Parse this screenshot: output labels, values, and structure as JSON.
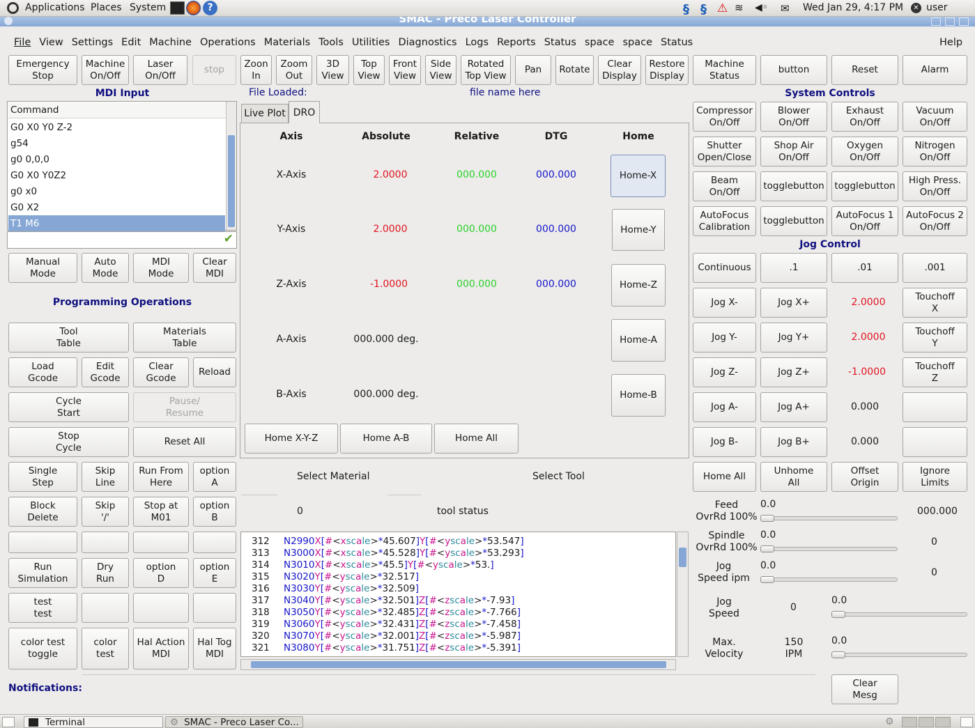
{
  "panel": {
    "apps": "Applications",
    "places": "Places",
    "system": "System",
    "datetime": "Wed Jan 29,  4:17 PM",
    "user": "user"
  },
  "window": {
    "title": "SMAC - Preco Laser Controller"
  },
  "menu": [
    "File",
    "View",
    "Settings",
    "Edit",
    "Machine",
    "Operations",
    "Materials",
    "Tools",
    "Utilities",
    "Diagnostics",
    "Logs",
    "Reports",
    "Status",
    "space",
    "space",
    "Status"
  ],
  "menu_help": "Help",
  "toolbar": {
    "emergency": "Emergency\nStop",
    "machine": "Machine\nOn/Off",
    "laser": "Laser\nOn/Off",
    "stop": "stop",
    "zoom_in": "Zoon\nIn",
    "zoom_out": "Zoom\nOut",
    "view3d": "3D\nView",
    "top": "Top\nView",
    "front": "Front\nView",
    "side": "Side\nView",
    "rotated": "Rotated\nTop View",
    "pan": "Pan",
    "rotate": "Rotate",
    "clear": "Clear\nDisplay",
    "restore": "Restore\nDisplay",
    "mstatus": "Machine\nStatus",
    "button": "button",
    "reset": "Reset",
    "alarm": "Alarm"
  },
  "mdi": {
    "title": "MDI Input",
    "column": "Command",
    "commands": [
      "G0 X0 Y0 Z-2",
      "g54",
      "g0 0,0,0",
      "G0 X0 Y0Z2",
      "g0 x0",
      "G0 X2",
      "T1 M6"
    ],
    "selected": 6
  },
  "modes": {
    "manual": "Manual\nMode",
    "auto": "Auto\nMode",
    "mdi": "MDI\nMode",
    "clear": "Clear\nMDI"
  },
  "prog": {
    "title": "Programming Operations",
    "tool_table": "Tool\nTable",
    "materials_table": "Materials\nTable",
    "load": "Load\nGcode",
    "edit": "Edit\nGcode",
    "clear": "Clear\nGcode",
    "reload": "Reload",
    "cycle_start": "Cycle\nStart",
    "pause": "Pause/\nResume",
    "stop_cycle": "Stop\nCycle",
    "reset_all": "Reset All",
    "single_step": "Single\nStep",
    "skip_line": "Skip\nLine",
    "run_from": "Run From\nHere",
    "option_a": "option\nA",
    "block_delete": "Block\nDelete",
    "skip_slash": "Skip\n'/'",
    "stop_m01": "Stop at\nM01",
    "option_b": "option\nB",
    "run_sim": "Run\nSimulation",
    "dry_run": "Dry\nRun",
    "option_d": "option\nD",
    "option_e": "option\nE",
    "test": "test\ntest",
    "color_toggle": "color test\ntoggle",
    "color_test": "color\ntest",
    "hal_action": "Hal Action\nMDI",
    "hal_tog": "Hal Tog\nMDI"
  },
  "notifications": "Notifications:",
  "file": {
    "label": "File Loaded:",
    "name": "file name here"
  },
  "tabs": [
    "Live Plot",
    "DRO"
  ],
  "dro": {
    "headers": [
      "Axis",
      "Absolute",
      "Relative",
      "DTG",
      "Home"
    ],
    "rows": [
      {
        "axis": "X-Axis",
        "abs": "2.0000",
        "rel": "000.000",
        "dtg": "000.000",
        "home": "Home-X"
      },
      {
        "axis": "Y-Axis",
        "abs": "2.0000",
        "rel": "000.000",
        "dtg": "000.000",
        "home": "Home-Y"
      },
      {
        "axis": "Z-Axis",
        "abs": "-1.0000",
        "rel": "000.000",
        "dtg": "000.000",
        "home": "Home-Z"
      },
      {
        "axis": "A-Axis",
        "abs": "000.000 deg.",
        "rel": "",
        "dtg": "",
        "home": "Home-A"
      },
      {
        "axis": "B-Axis",
        "abs": "000.000 deg.",
        "rel": "",
        "dtg": "",
        "home": "Home-B"
      }
    ],
    "home_xyz": "Home X-Y-Z",
    "home_ab": "Home A-B",
    "home_all": "Home All"
  },
  "select_material": "Select Material",
  "select_tool": "Select Tool",
  "material_value": "0",
  "tool_status": "tool status",
  "gcode": [
    {
      "n": "312",
      "t": "N2990X[#<xscale>*45.607]Y[#<yscale>*53.547]"
    },
    {
      "n": "313",
      "t": "N3000X[#<xscale>*45.528]Y[#<yscale>*53.293]"
    },
    {
      "n": "314",
      "t": "N3010X[#<xscale>*45.5]Y[#<yscale>*53.]"
    },
    {
      "n": "315",
      "t": "N3020Y[#<yscale>*32.517]"
    },
    {
      "n": "316",
      "t": "N3030Y[#<yscale>*32.509]"
    },
    {
      "n": "317",
      "t": "N3040Y[#<yscale>*32.501]Z[#<zscale>*-7.93]"
    },
    {
      "n": "318",
      "t": "N3050Y[#<yscale>*32.485]Z[#<zscale>*-7.766]"
    },
    {
      "n": "319",
      "t": "N3060Y[#<yscale>*32.431]Z[#<zscale>*-7.458]"
    },
    {
      "n": "320",
      "t": "N3070Y[#<yscale>*32.001]Z[#<zscale>*-5.987]"
    },
    {
      "n": "321",
      "t": "N3080Y[#<yscale>*31.751]Z[#<zscale>*-5.391]"
    }
  ],
  "sys": {
    "title": "System Controls",
    "compressor": "Compressor\nOn/Off",
    "blower": "Blower\nOn/Off",
    "exhaust": "Exhaust\nOn/Off",
    "vacuum": "Vacuum\nOn/Off",
    "shutter": "Shutter\nOpen/Close",
    "shop_air": "Shop Air\nOn/Off",
    "oxygen": "Oxygen\nOn/Off",
    "nitrogen": "Nitrogen\nOn/Off",
    "beam": "Beam\nOn/Off",
    "toggle1": "togglebutton",
    "toggle2": "togglebutton",
    "high_press": "High Press.\nOn/Off",
    "af_cal": "AutoFocus\nCalibration",
    "toggle3": "togglebutton",
    "af1": "AutoFocus 1\nOn/Off",
    "af2": "AutoFocus 2\nOn/Off"
  },
  "jog": {
    "title": "Jog Control",
    "continuous": "Continuous",
    "inc1": ".1",
    "inc2": ".01",
    "inc3": ".001",
    "rows": [
      {
        "minus": "Jog X-",
        "plus": "Jog X+",
        "val": "2.0000",
        "touch": "Touchoff\nX"
      },
      {
        "minus": "Jog Y-",
        "plus": "Jog Y+",
        "val": "2.0000",
        "touch": "Touchoff\nY"
      },
      {
        "minus": "Jog Z-",
        "plus": "Jog Z+",
        "val": "-1.0000",
        "touch": "Touchoff\nZ"
      },
      {
        "minus": "Jog A-",
        "plus": "Jog A+",
        "val": "0.000",
        "touch": ""
      },
      {
        "minus": "Jog B-",
        "plus": "Jog B+",
        "val": "0.000",
        "touch": ""
      }
    ],
    "home_all": "Home All",
    "unhome_all": "Unhome\nAll",
    "offset_origin": "Offset\nOrigin",
    "ignore_limits": "Ignore\nLimits"
  },
  "overrides": {
    "feed_label": "Feed\nOvrRd 100%",
    "feed_val": "0.0",
    "feed_out": "000.000",
    "spindle_label": "Spindle\nOvrRd 100%",
    "spindle_val": "0.0",
    "spindle_out": "0",
    "jogspeed_label": "Jog\nSpeed ipm",
    "jogspeed_val": "0.0",
    "jogspeed_out": "0",
    "jog_speed_label": "Jog\nSpeed",
    "jog_speed_mid": "0",
    "jog_speed_val": "0.0",
    "maxvel_label": "Max.\nVelocity",
    "maxvel_mid": "150\nIPM",
    "maxvel_val": "0.0",
    "clear_mesg": "Clear\nMesg"
  },
  "taskbar": {
    "terminal": "Terminal",
    "smac": "SMAC - Preco Laser Co..."
  },
  "colors": {
    "red": "#e0141e",
    "green": "#2ad12a",
    "blue": "#1414c8",
    "navy": "#0f0f7f",
    "select": "#86a7d6"
  }
}
